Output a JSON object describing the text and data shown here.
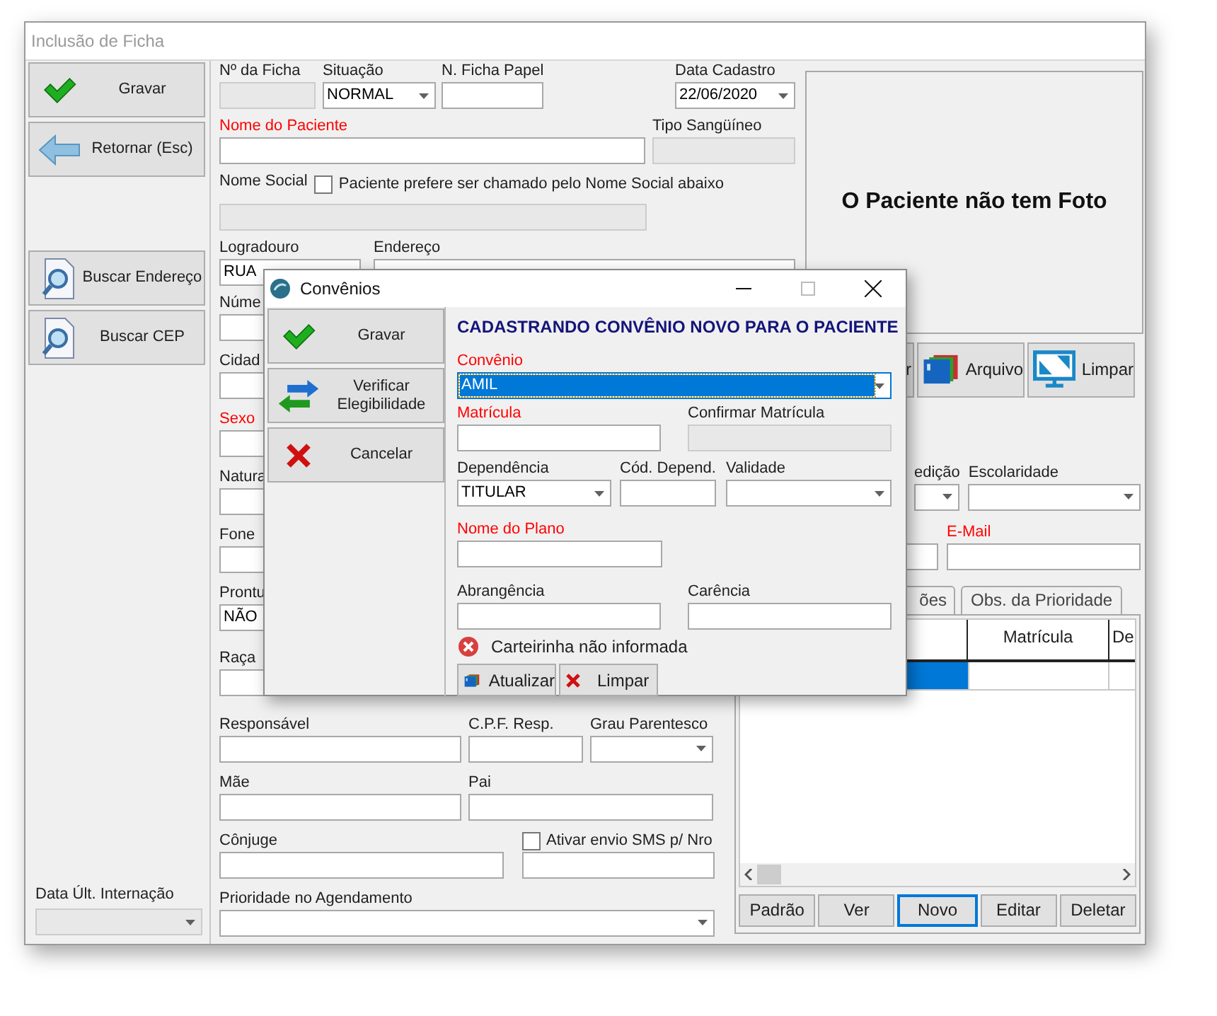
{
  "window": {
    "title": "Inclusão de Ficha"
  },
  "side_buttons": [
    {
      "label": "Gravar",
      "kind": "check"
    },
    {
      "label": "Retornar (Esc)",
      "kind": "back"
    },
    {
      "label": "Buscar Endereço",
      "kind": "search"
    },
    {
      "label": "Buscar CEP",
      "kind": "search"
    }
  ],
  "last_admission": {
    "label": "Data Últ. Internação",
    "kind": "combo",
    "disabled": true,
    "required": false
  },
  "form": {
    "fields": [
      {
        "label": "Nº da Ficha",
        "kind": "text",
        "disabled": true,
        "required": false
      },
      {
        "label": "Situação",
        "kind": "combo",
        "value": "NORMAL",
        "disabled": false,
        "required": false
      },
      {
        "label": "N. Ficha Papel",
        "kind": "text",
        "disabled": false,
        "required": false
      },
      {
        "label": "Data Cadastro",
        "kind": "combo",
        "value": "22/06/2020",
        "disabled": false,
        "required": false
      },
      {
        "label": "Nome do Paciente",
        "kind": "text",
        "disabled": false,
        "required": true
      },
      {
        "label": "Tipo Sangüíneo",
        "kind": "text",
        "disabled": true,
        "required": false
      },
      {
        "label": "Nome Social",
        "kind": "text",
        "disabled": true,
        "required": false
      },
      {
        "label": "Logradouro",
        "kind": "combo",
        "value": "RUA",
        "disabled": false,
        "required": false
      },
      {
        "label": "Endereço",
        "kind": "text",
        "disabled": false,
        "required": false
      },
      {
        "label": "Núme",
        "kind": "text",
        "disabled": false,
        "required": false
      },
      {
        "label": "Cidad",
        "kind": "text",
        "disabled": false,
        "required": false
      },
      {
        "label": "Sexo",
        "kind": "text",
        "disabled": false,
        "required": true
      },
      {
        "label": "Natura",
        "kind": "text",
        "disabled": false,
        "required": false
      },
      {
        "label": "Fone",
        "kind": "text",
        "disabled": false,
        "required": false
      },
      {
        "label": "Prontu",
        "kind": "text",
        "value": "NÃO",
        "disabled": false,
        "required": false
      },
      {
        "label": "Raça",
        "kind": "text",
        "disabled": false,
        "required": false
      },
      {
        "label": "Responsável",
        "kind": "text",
        "disabled": false,
        "required": false
      },
      {
        "label": "C.P.F. Resp.",
        "kind": "text",
        "disabled": false,
        "required": false
      },
      {
        "label": "Grau Parentesco",
        "kind": "combo",
        "disabled": false,
        "required": false
      },
      {
        "label": "Mãe",
        "kind": "text",
        "disabled": false,
        "required": false
      },
      {
        "label": "Pai",
        "kind": "text",
        "disabled": false,
        "required": false
      },
      {
        "label": "Cônjuge",
        "kind": "text",
        "disabled": false,
        "required": false
      },
      {
        "label": "Prioridade no Agendamento",
        "kind": "combo",
        "disabled": false,
        "required": false
      }
    ],
    "social_name_pref": {
      "label": "Paciente prefere ser chamado pelo Nome Social abaixo",
      "checked": false
    },
    "sms": {
      "label": "Ativar envio SMS p/ Nro",
      "checked": false
    }
  },
  "photo": {
    "text": "O Paciente não tem Foto"
  },
  "toolbar": [
    {
      "label": "r",
      "kind": "plain"
    },
    {
      "label": "Arquivo",
      "kind": "cards"
    },
    {
      "label": "Limpar",
      "kind": "screen"
    }
  ],
  "right_fields": [
    {
      "label": "edição",
      "kind": "combo",
      "disabled": false,
      "required": false
    },
    {
      "label": "Escolaridade",
      "kind": "combo",
      "disabled": false,
      "required": false
    },
    {
      "label": "E-Mail",
      "kind": "text",
      "disabled": false,
      "required": true
    }
  ],
  "tabs": [
    {
      "label": "ões",
      "selected": false
    },
    {
      "label": "Obs. da Prioridade",
      "selected": false
    }
  ],
  "grid": {
    "columns": [
      "Matrícula",
      "De"
    ],
    "rows": [
      {
        "selected": true
      }
    ]
  },
  "grid_buttons": [
    {
      "label": "Padrão",
      "focused": false
    },
    {
      "label": "Ver",
      "focused": false
    },
    {
      "label": "Novo",
      "focused": true
    },
    {
      "label": "Editar",
      "focused": false
    },
    {
      "label": "Deletar",
      "focused": false
    }
  ],
  "dialog": {
    "title": "Convênios",
    "buttons": [
      {
        "label": "Gravar",
        "kind": "check"
      },
      {
        "label": "Verificar Elegibilidade",
        "kind": "swap"
      },
      {
        "label": "Cancelar",
        "kind": "cancel"
      }
    ],
    "heading": "CADASTRANDO CONVÊNIO NOVO PARA O PACIENTE",
    "fields": [
      {
        "label": "Convênio",
        "kind": "combo",
        "value": "AMIL",
        "disabled": false,
        "required": true,
        "focused": true
      },
      {
        "label": "Matrícula",
        "kind": "text",
        "disabled": false,
        "required": true,
        "focused": false
      },
      {
        "label": "Confirmar Matrícula",
        "kind": "text",
        "disabled": true,
        "required": false,
        "focused": false
      },
      {
        "label": "Dependência",
        "kind": "combo",
        "value": "TITULAR",
        "disabled": false,
        "required": false,
        "focused": false
      },
      {
        "label": "Cód. Depend.",
        "kind": "text",
        "disabled": false,
        "required": false,
        "focused": false
      },
      {
        "label": "Validade",
        "kind": "combo",
        "disabled": false,
        "required": false,
        "focused": false
      },
      {
        "label": "Nome do Plano",
        "kind": "text",
        "disabled": false,
        "required": true,
        "focused": false
      },
      {
        "label": "Abrangência",
        "kind": "text",
        "disabled": false,
        "required": false,
        "focused": false
      },
      {
        "label": "Carência",
        "kind": "text",
        "disabled": false,
        "required": false,
        "focused": false
      }
    ],
    "card_status": "Carteirinha não informada",
    "actions": [
      {
        "label": "Atualizar",
        "kind": "card"
      },
      {
        "label": "Limpar",
        "kind": "clear"
      }
    ]
  }
}
